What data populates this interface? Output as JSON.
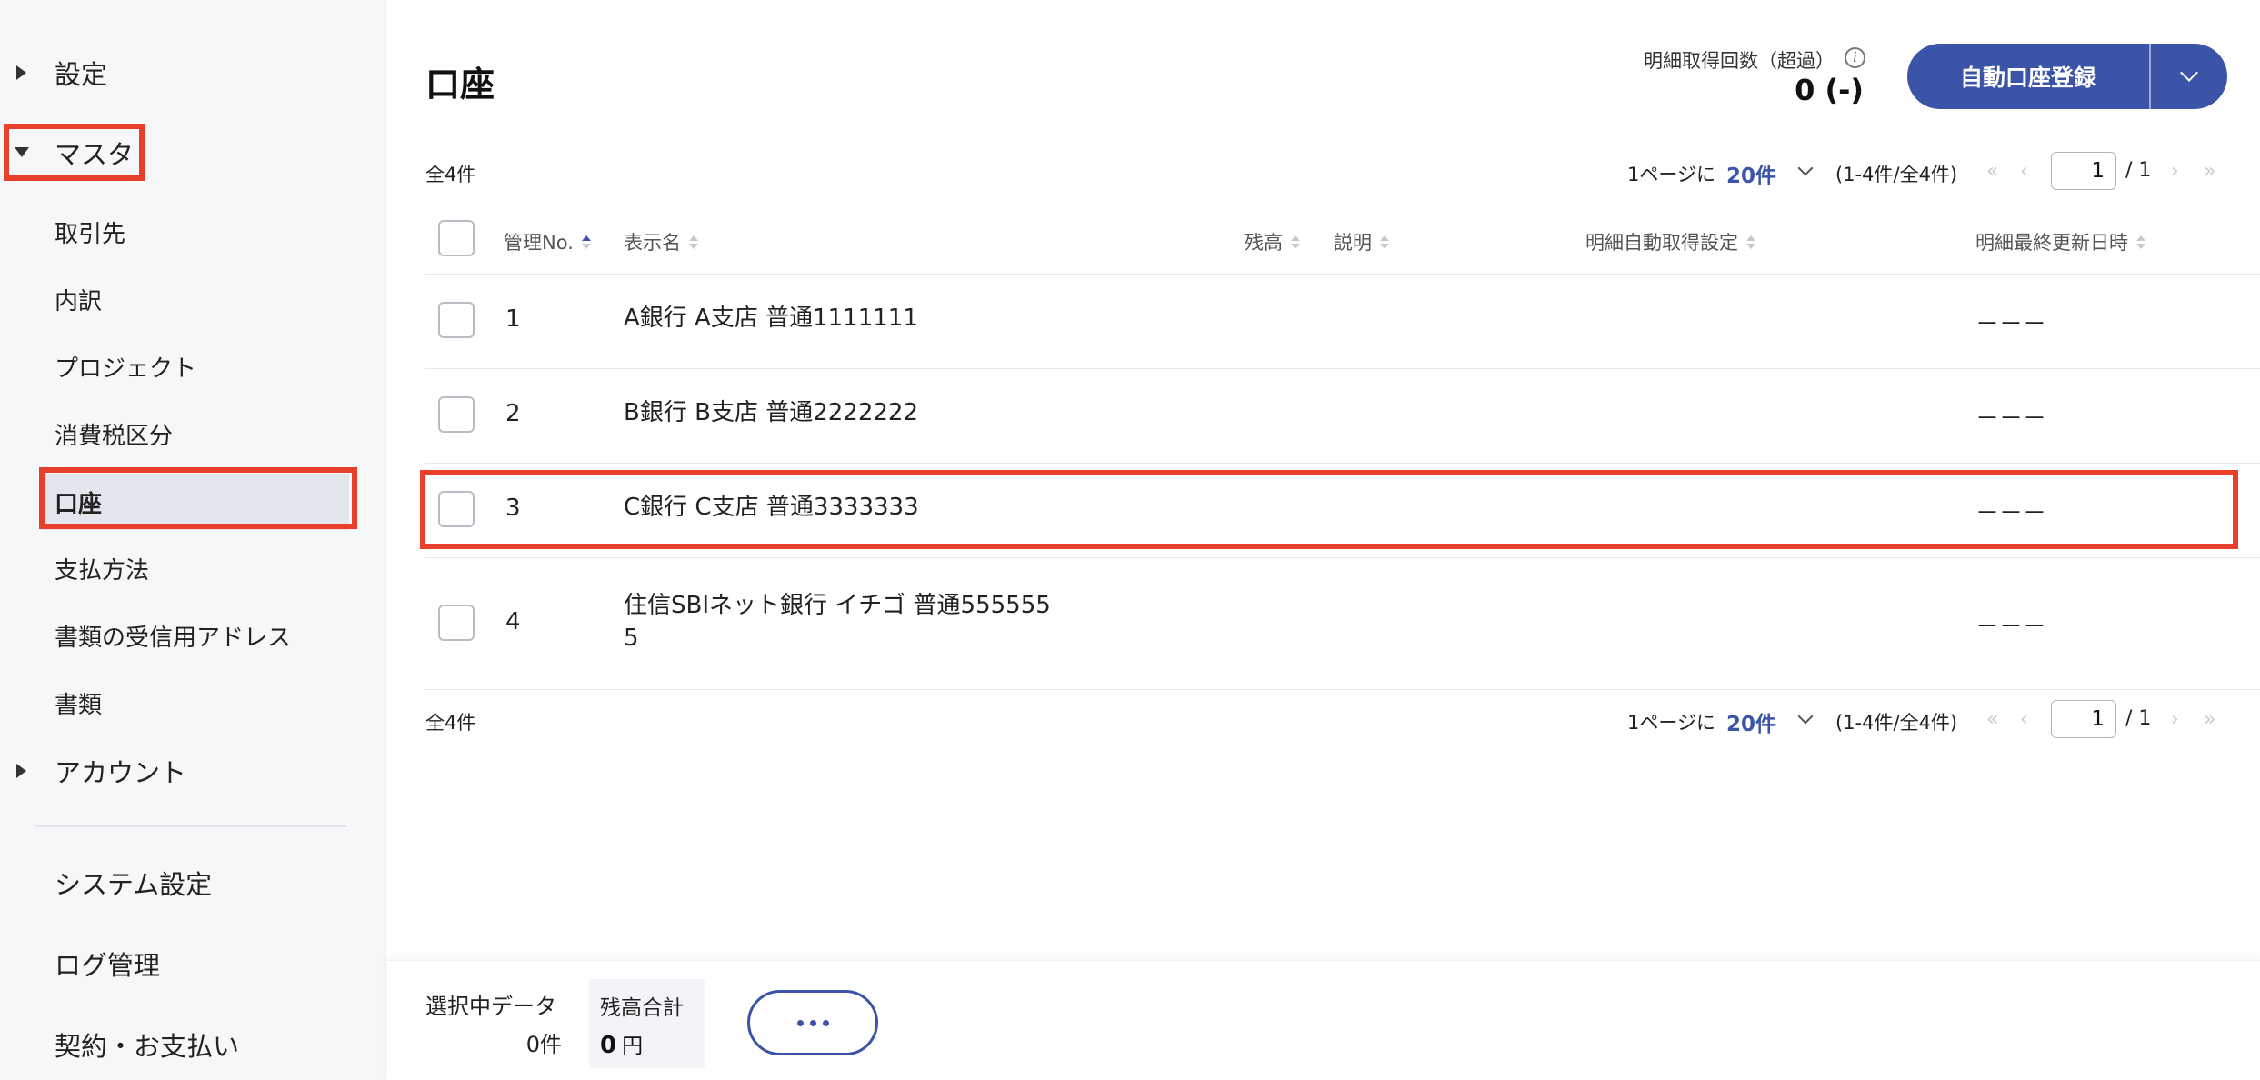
{
  "sidebar": {
    "settings": "設定",
    "master": "マスタ",
    "items": [
      {
        "label": "取引先"
      },
      {
        "label": "内訳"
      },
      {
        "label": "プロジェクト"
      },
      {
        "label": "消費税区分"
      },
      {
        "label": "口座"
      },
      {
        "label": "支払方法"
      },
      {
        "label": "書類の受信用アドレス"
      },
      {
        "label": "書類"
      }
    ],
    "account": "アカウント",
    "bottom": [
      {
        "label": "システム設定"
      },
      {
        "label": "ログ管理"
      },
      {
        "label": "契約・お支払い"
      }
    ]
  },
  "header": {
    "title": "口座",
    "quota_label": "明細取得回数（超過）",
    "quota_value": "0 (-)",
    "primary_button": "自動口座登録"
  },
  "pager": {
    "total": "全4件",
    "per_page_label": "1ページに",
    "per_page_value": "20件",
    "range": "(1-4件/全4件)",
    "current_page": "1",
    "of_pages": "/ 1",
    "first": "«",
    "prev": "‹",
    "next": "›",
    "last": "»"
  },
  "table": {
    "columns": [
      "管理No.",
      "表示名",
      "残高",
      "説明",
      "明細自動取得設定",
      "明細最終更新日時"
    ],
    "rows": [
      {
        "no": "1",
        "name": "A銀行 A支店 普通1111111",
        "balance": "",
        "description": "",
        "auto_setting": "",
        "last_updated": "－－－"
      },
      {
        "no": "2",
        "name": "B銀行 B支店 普通2222222",
        "balance": "",
        "description": "",
        "auto_setting": "",
        "last_updated": "－－－"
      },
      {
        "no": "3",
        "name": "C銀行 C支店 普通3333333",
        "balance": "",
        "description": "",
        "auto_setting": "",
        "last_updated": "－－－"
      },
      {
        "no": "4",
        "name": "住信SBIネット銀行 イチゴ 普通5555555",
        "balance": "",
        "description": "",
        "auto_setting": "",
        "last_updated": "－－－"
      }
    ]
  },
  "bottombar": {
    "selected_label": "選択中データ",
    "selected_value": "0件",
    "balance_label": "残高合計",
    "balance_value": "0",
    "balance_unit": "円"
  },
  "colors": {
    "accent": "#3b54a7",
    "highlight": "#e8402a"
  }
}
